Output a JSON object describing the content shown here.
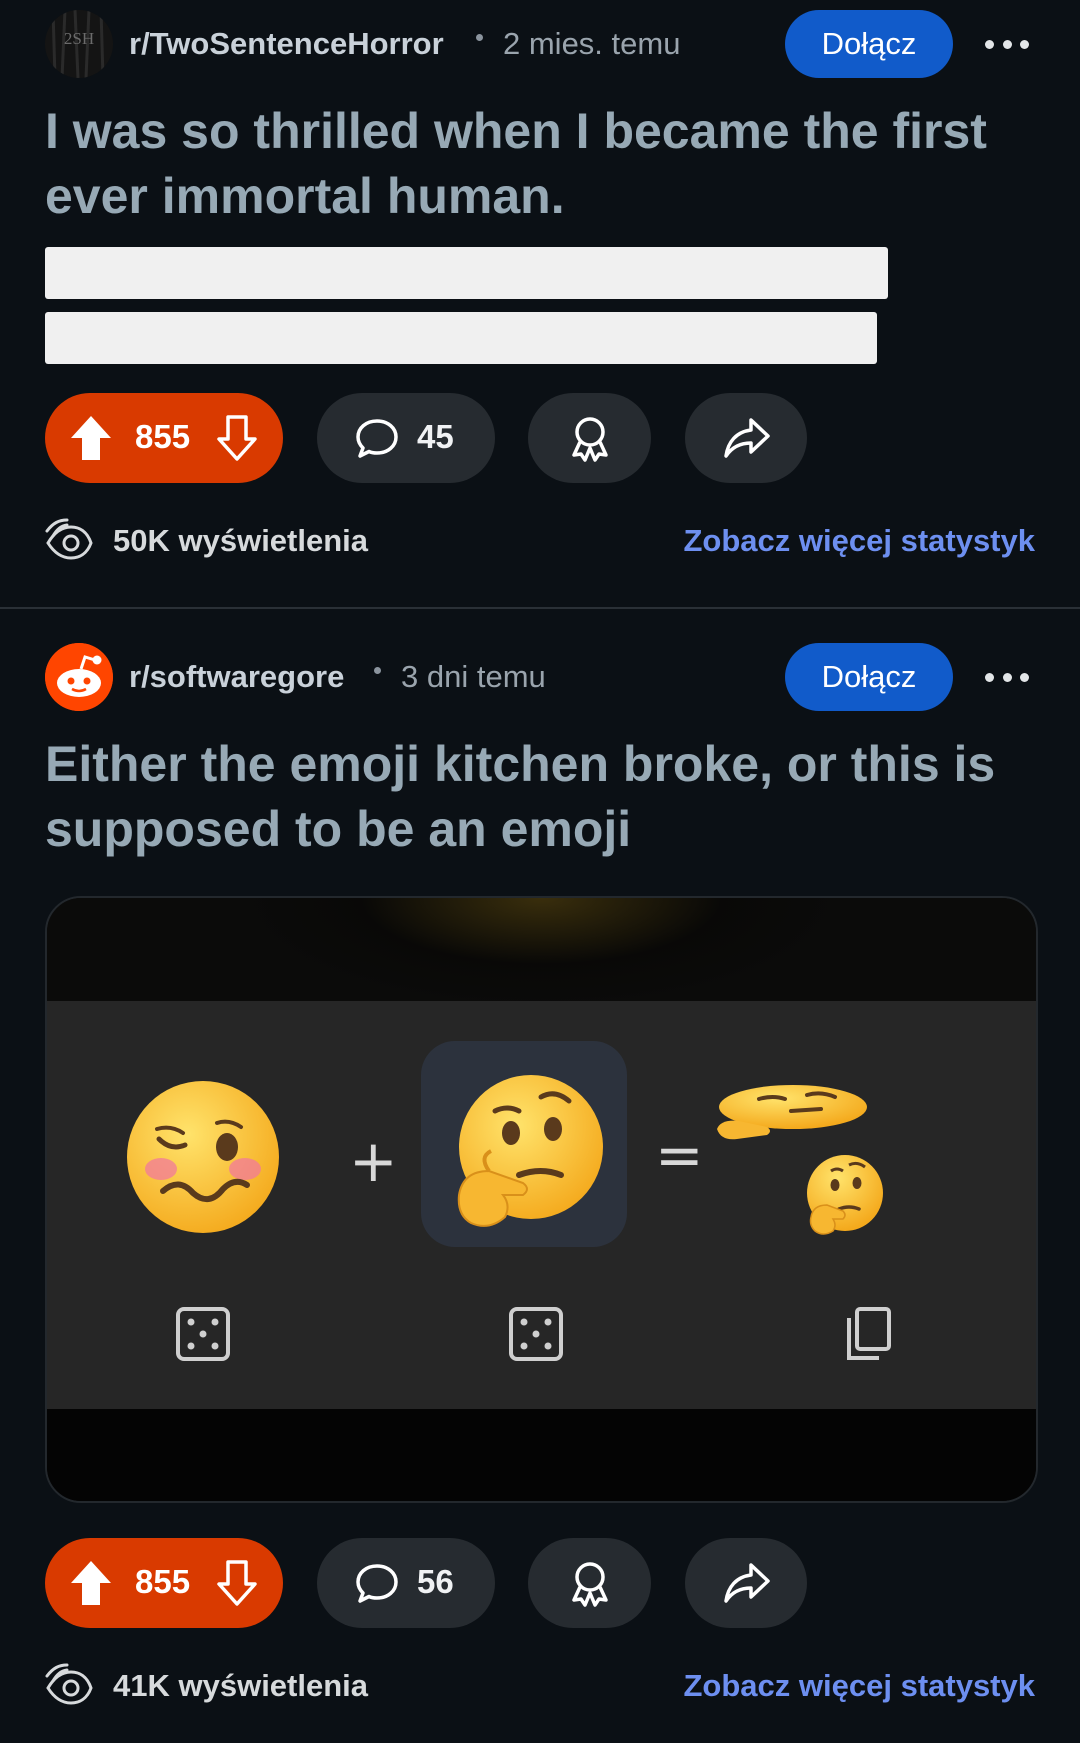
{
  "posts": [
    {
      "subreddit": "r/TwoSentenceHorror",
      "avatar_text": "2SH",
      "time": "2 mies. temu",
      "join_label": "Dołącz",
      "title": "I was so thrilled when I became the first ever immortal human.",
      "spoiler_lines": 2,
      "votes": "855",
      "comments": "45",
      "views": "50K wyświetlenia",
      "stats_link": "Zobacz więcej statystyk"
    },
    {
      "subreddit": "r/softwaregore",
      "time": "3 dni temu",
      "join_label": "Dołącz",
      "title": "Either the emoji kitchen broke, or this is supposed to be an emoji",
      "image": {
        "plus": "+",
        "equals": "=",
        "emoji_left": "woozy-face",
        "emoji_middle": "thinking-face",
        "emoji_result": "broken-mashup"
      },
      "votes": "855",
      "comments": "56",
      "views": "41K wyświetlenia",
      "stats_link": "Zobacz więcej statystyk"
    }
  ],
  "colors": {
    "background": "#0b1015",
    "join": "#115bca",
    "upvoted": "#d93a00",
    "pill": "#262b30",
    "link": "#6d8ff0"
  },
  "icons": [
    "upvote-icon",
    "downvote-icon",
    "comment-icon",
    "award-icon",
    "share-icon",
    "views-icon",
    "more-icon",
    "dice-icon",
    "copy-icon"
  ]
}
